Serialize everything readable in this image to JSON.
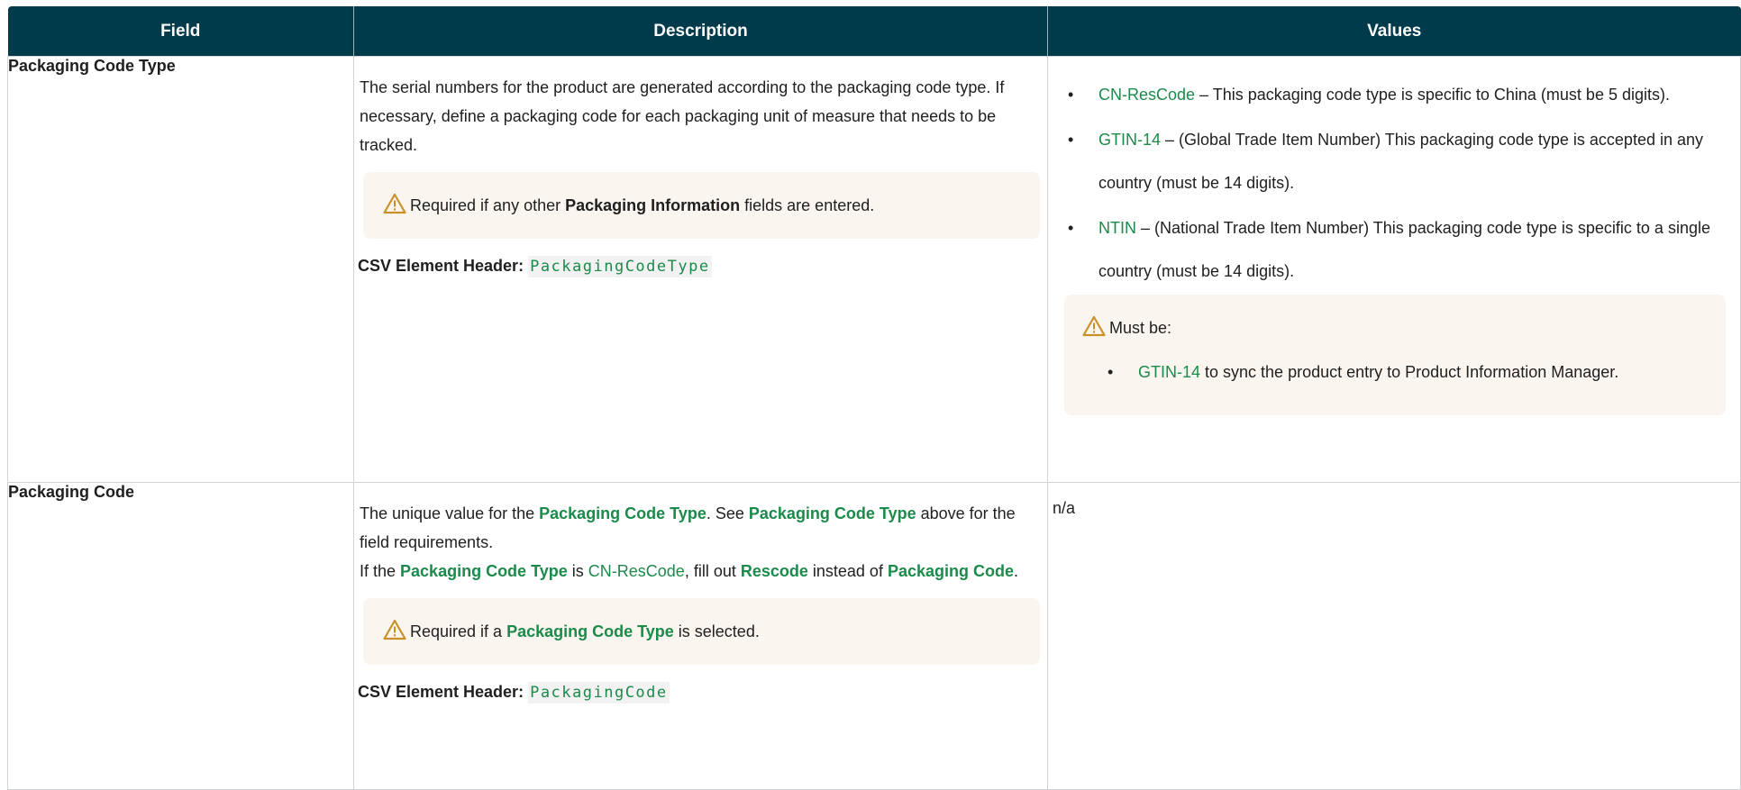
{
  "headers": {
    "field": "Field",
    "description": "Description",
    "values": "Values"
  },
  "colors": {
    "header_bg": "#003b4c",
    "accent_green": "#1b8a4a",
    "callout_bg": "#faf6ef",
    "warning_icon": "#c8912a"
  },
  "rows": [
    {
      "field": "Packaging Code Type",
      "desc_text": "The serial numbers for the product are generated according to the packaging code type. If necessary, define a packaging code for each packaging unit of measure that needs to be tracked.",
      "callout": {
        "icon": "warning-icon",
        "pre": "Required if any other ",
        "term": "Packaging Information",
        "post": " fields are entered."
      },
      "csv_label": "CSV Element Header:",
      "csv_value": "PackagingCodeType",
      "values": [
        {
          "name": "CN-ResCode",
          "text": " – This packaging code type is specific to China (must be 5 digits)."
        },
        {
          "name": "GTIN-14",
          "text": " – (Global Trade Item Number) This packaging code type is accepted in any country (must be 14 digits)."
        },
        {
          "name": "NTIN",
          "text": " – (National Trade Item Number) This packaging code type is specific to a single country (must be 14 digits)."
        }
      ],
      "values_callout": {
        "icon": "warning-icon",
        "head": "Must be:",
        "item_name": "GTIN-14",
        "item_text": " to sync the product entry to Product Information Manager."
      }
    },
    {
      "field": "Packaging Code",
      "p1": {
        "a": "The unique value for the ",
        "t1": "Packaging Code Type",
        "b": ". See ",
        "t2": "Packaging Code Type",
        "c": " above for the field requirements."
      },
      "p2": {
        "a": "If the ",
        "t1": "Packaging Code Type",
        "b": " is ",
        "link": "CN-ResCode",
        "c": ", fill out ",
        "t2": "Rescode",
        "d": " instead of ",
        "t3": "Packaging Code",
        "e": "."
      },
      "callout": {
        "icon": "warning-icon",
        "pre": "Required if a ",
        "term": "Packaging Code Type",
        "post": " is selected."
      },
      "csv_label": "CSV Element Header:",
      "csv_value": "PackagingCode",
      "values_text": "n/a"
    }
  ]
}
